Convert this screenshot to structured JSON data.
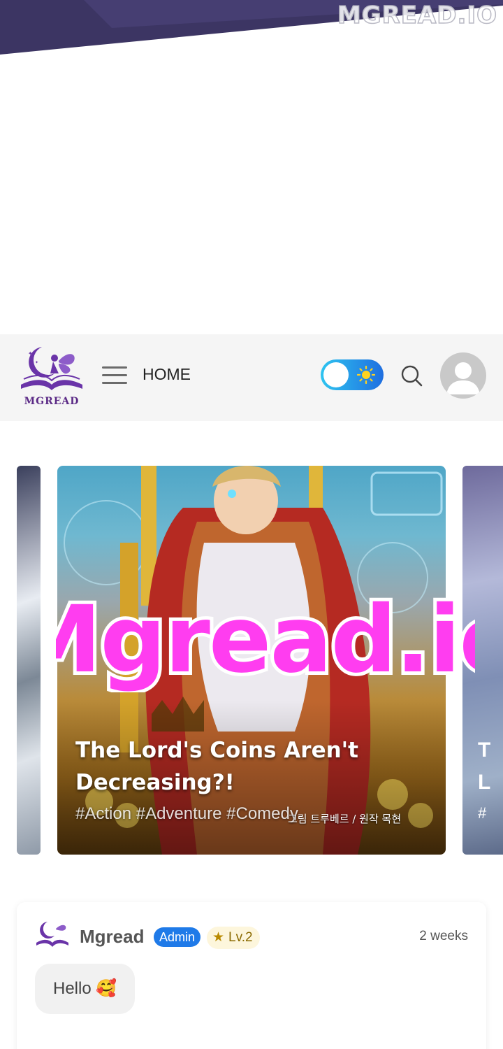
{
  "watermark": "MGREAD.IO",
  "header": {
    "logo_text": "MGREAD",
    "home_label": "HOME"
  },
  "carousel": {
    "main_slide": {
      "title": "The Lord's Coins Aren't Decreasing?!",
      "tags": "#Action #Adventure #Comedy",
      "credit": "그림 트루베르 / 원작 목현"
    },
    "right_slide_partial_title": "T\nL",
    "right_slide_partial_tag": "#"
  },
  "overlay_watermark": "Mgread.io",
  "comment": {
    "user": "Mgread",
    "role_badge": "Admin",
    "level_badge": "Lv.2",
    "time": "2 weeks",
    "text": "Hello 🥰"
  },
  "colors": {
    "toggle_start": "#2ec4f0",
    "toggle_end": "#1f6fe0",
    "admin_badge": "#1f7ae8",
    "logo_purple": "#5b2a86",
    "watermark_pink": "#ff3df0"
  }
}
